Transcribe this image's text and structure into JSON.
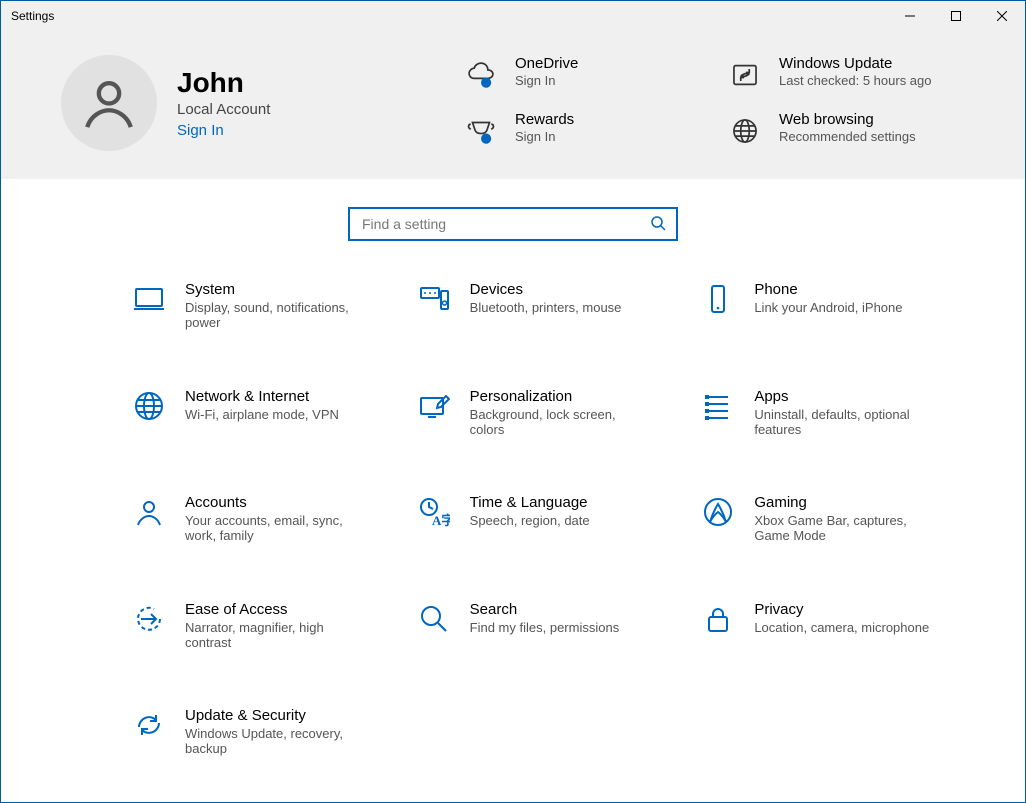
{
  "window": {
    "title": "Settings"
  },
  "profile": {
    "name": "John",
    "account_type": "Local Account",
    "signin": "Sign In"
  },
  "tiles": {
    "onedrive": {
      "title": "OneDrive",
      "sub": "Sign In"
    },
    "update": {
      "title": "Windows Update",
      "sub": "Last checked: 5 hours ago"
    },
    "rewards": {
      "title": "Rewards",
      "sub": "Sign In"
    },
    "web": {
      "title": "Web browsing",
      "sub": "Recommended settings"
    }
  },
  "search": {
    "placeholder": "Find a setting"
  },
  "cats": {
    "system": {
      "title": "System",
      "sub": "Display, sound, notifications, power"
    },
    "devices": {
      "title": "Devices",
      "sub": "Bluetooth, printers, mouse"
    },
    "phone": {
      "title": "Phone",
      "sub": "Link your Android, iPhone"
    },
    "network": {
      "title": "Network & Internet",
      "sub": "Wi-Fi, airplane mode, VPN"
    },
    "personal": {
      "title": "Personalization",
      "sub": "Background, lock screen, colors"
    },
    "apps": {
      "title": "Apps",
      "sub": "Uninstall, defaults, optional features"
    },
    "accounts": {
      "title": "Accounts",
      "sub": "Your accounts, email, sync, work, family"
    },
    "time": {
      "title": "Time & Language",
      "sub": "Speech, region, date"
    },
    "gaming": {
      "title": "Gaming",
      "sub": "Xbox Game Bar, captures, Game Mode"
    },
    "ease": {
      "title": "Ease of Access",
      "sub": "Narrator, magnifier, high contrast"
    },
    "srch": {
      "title": "Search",
      "sub": "Find my files, permissions"
    },
    "privacy": {
      "title": "Privacy",
      "sub": "Location, camera, microphone"
    },
    "updatesec": {
      "title": "Update & Security",
      "sub": "Windows Update, recovery, backup"
    }
  }
}
